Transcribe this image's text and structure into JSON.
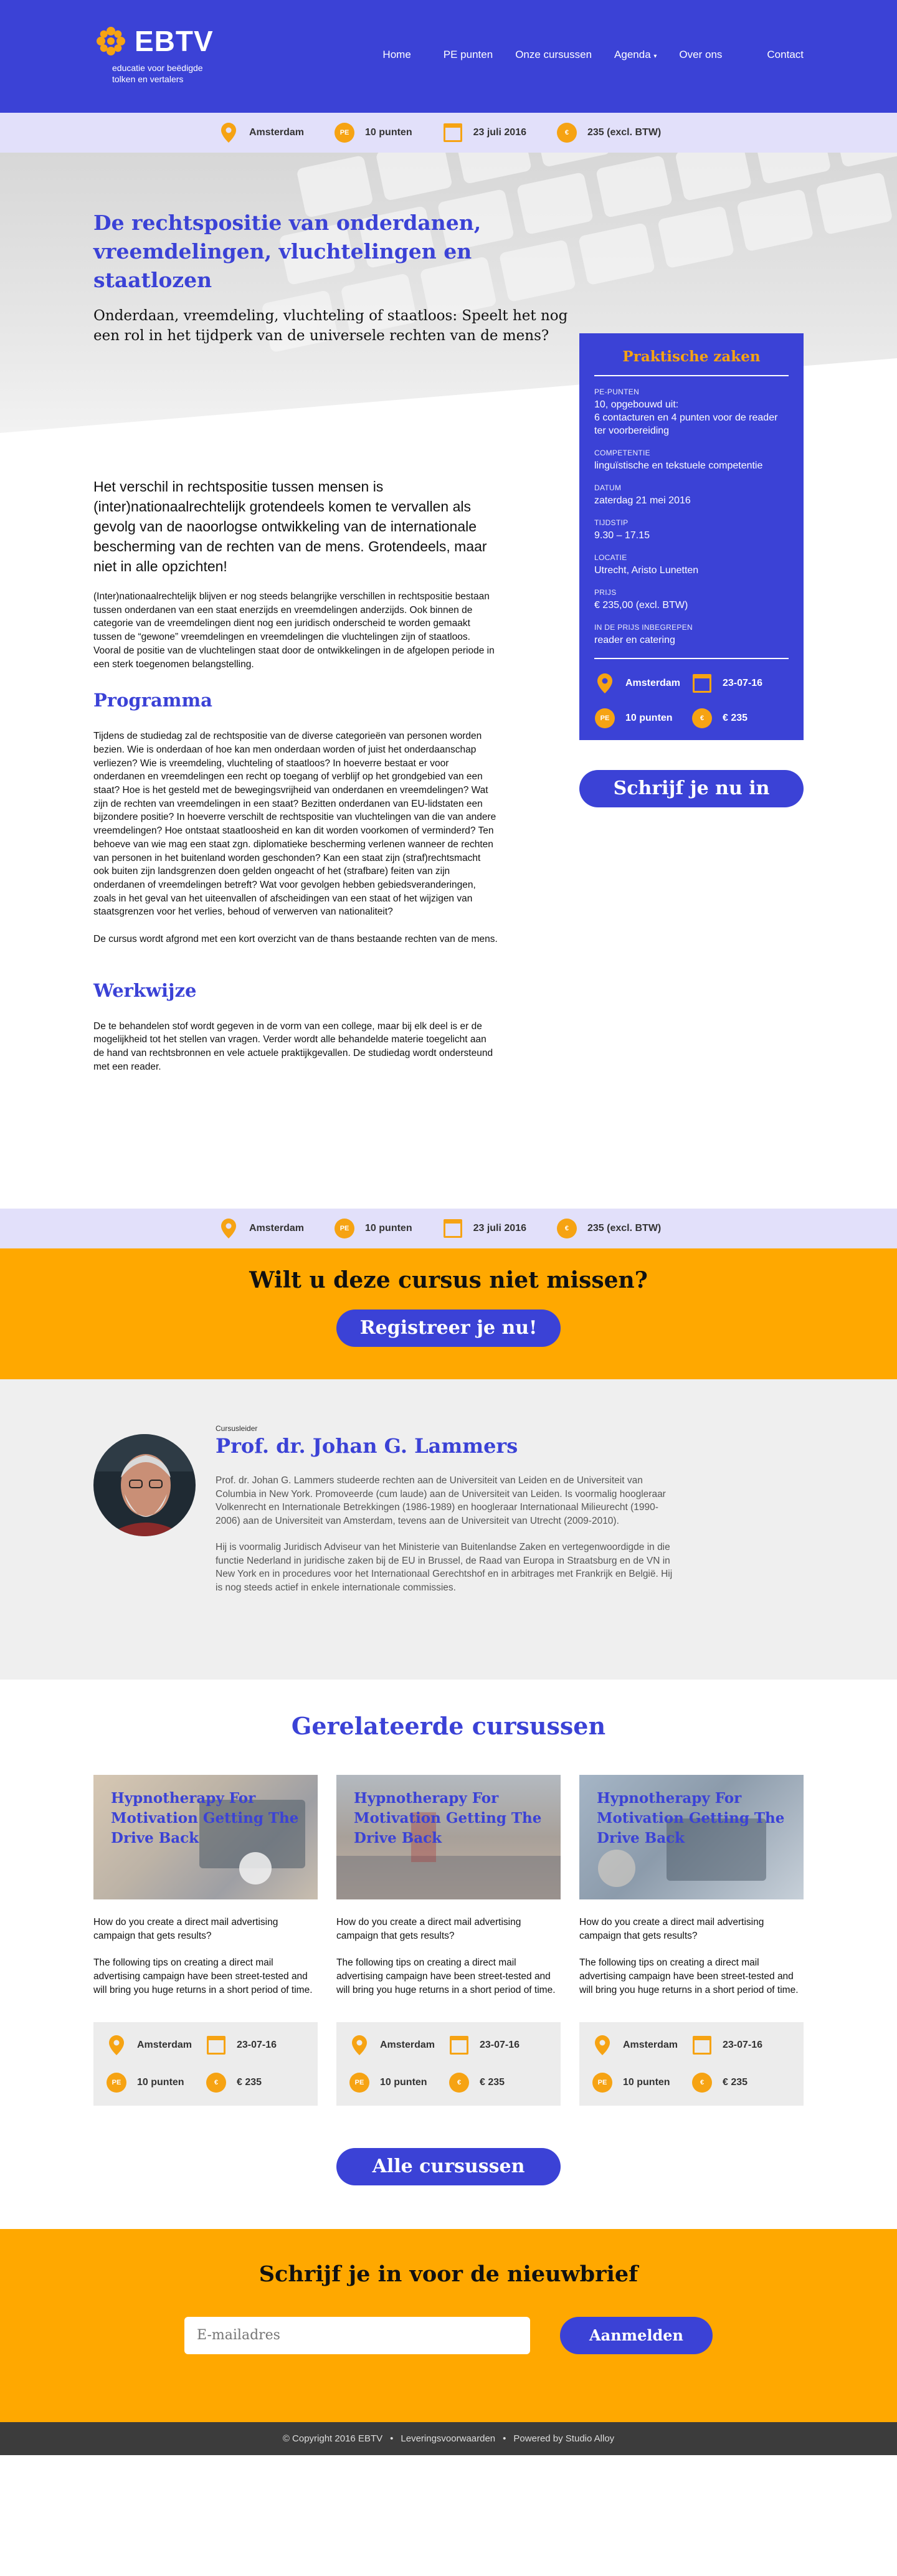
{
  "header": {
    "logo_word": "EBTV",
    "logo_sub_1": "educatie voor beëdigde",
    "logo_sub_2": "tolken en vertalers",
    "nav": [
      "Home",
      "PE punten",
      "Onze cursussen",
      "Agenda",
      "Over ons",
      "Contact"
    ]
  },
  "infobar": {
    "location": "Amsterdam",
    "points": "10 punten",
    "date": "23 juli 2016",
    "price": "235 (excl. BTW)",
    "pe_badge": "PE",
    "euro_badge": "€"
  },
  "hero": {
    "title": "De rechtspositie van onderdanen, vreemdelingen, vluchtelingen en staatlozen",
    "subtitle": "Onderdaan, vreemdeling, vluchteling of staatloos: Speelt het nog een rol in het tijdperk van de universele rechten van de mens?"
  },
  "content": {
    "lead": "Het verschil in rechtspositie tussen mensen is (inter)nationaalrechtelijk grotendeels komen te vervallen als gevolg van de naoorlogse ontwikkeling van de internationale bescherming van de rechten van de mens. Grotendeels, maar niet in alle opzichten!",
    "intro_1": "(Inter)nationaalrechtelijk blijven er nog steeds belangrijke verschillen in rechtspositie bestaan tussen onderdanen van een staat enerzijds en vreemdelingen anderzijds. Ook binnen de categorie van de vreemdelingen dient nog een juridisch onderscheid te worden gemaakt tussen de “gewone” vreemdelingen en vreemdelingen die vluchtelingen zijn of staatloos.",
    "intro_2": "Vooral de positie van de vluchtelingen staat door de ontwikkelingen in de afgelopen periode in een sterk toegenomen belangstelling.",
    "programma_title": "Programma",
    "programma_p1": "Tijdens de studiedag zal de rechtspositie van de diverse categorieën van personen worden bezien. Wie is onderdaan of hoe kan men onderdaan worden of juist het onderdaanschap verliezen? Wie is vreemdeling, vluchteling of staatloos? In hoeverre bestaat er voor onderdanen en vreemdelingen een recht op toegang of verblijf op het grondgebied van een staat? Hoe is het gesteld met de bewegingsvrijheid van onderdanen en vreemdelingen? Wat zijn de rechten van vreemdelingen in een staat? Bezitten onderdanen van EU-lidstaten een bijzondere positie? In hoeverre verschilt de rechtspositie van vluchtelingen van die van andere vreemdelingen? Hoe ontstaat staatloosheid en kan dit worden voorkomen of verminderd? Ten behoeve van wie mag een staat zgn. diplomatieke bescherming verlenen wanneer de rechten van personen in het buitenland worden geschonden? Kan een staat zijn (straf)rechtsmacht ook buiten zijn landsgrenzen doen gelden ongeacht of het (strafbare) feiten van zijn onderdanen of vreemdelingen betreft? Wat voor gevolgen hebben gebiedsveranderingen, zoals in het geval van het uiteenvallen of afscheidingen van een staat of het wijzigen van staatsgrenzen voor het verlies, behoud of verwerven van nationaliteit?",
    "programma_p2": "De cursus wordt afgrond met een kort overzicht van de thans bestaande rechten van de mens.",
    "werkwijze_title": "Werkwijze",
    "werkwijze_p": "De te behandelen stof wordt gegeven in de vorm van een college, maar bij elk deel is er de mogelijkheid tot het stellen van vragen. Verder wordt alle behandelde materie toegelicht aan de hand van rechtsbronnen en vele actuele praktijkgevallen. De studiedag wordt ondersteund met een reader."
  },
  "sidebar": {
    "title": "Praktische zaken",
    "rows": [
      {
        "label": "PE-punten",
        "value": "10, opgebouwd uit:\n6 contacturen en 4 punten voor de reader ter voorbereiding"
      },
      {
        "label": "Competentie",
        "value": "linguïstische en tekstuele competentie"
      },
      {
        "label": "Datum",
        "value": "zaterdag 21 mei 2016"
      },
      {
        "label": "Tijdstip",
        "value": "9.30 – 17.15"
      },
      {
        "label": "Locatie",
        "value": "Utrecht, Aristo Lunetten"
      },
      {
        "label": "Prijs",
        "value": "€ 235,00 (excl. BTW)"
      },
      {
        "label": "In de prijs inbegrepen",
        "value": "reader en catering"
      }
    ],
    "grid": {
      "location": "Amsterdam",
      "date": "23-07-16",
      "points": "10 punten",
      "price": "€ 235"
    },
    "button": "Schrijf je nu in"
  },
  "infobar2": {
    "location": "Amsterdam",
    "points": "10 punten",
    "date": "23 juli 2016",
    "price": "235 (excl. BTW)"
  },
  "cta": {
    "title": "Wilt u deze cursus niet missen?",
    "button": "Registreer je nu!"
  },
  "teacher": {
    "label": "Cursusleider",
    "name": "Prof. dr. Johan G. Lammers",
    "p1": "Prof. dr. Johan G. Lammers studeerde rechten aan de Universiteit van Leiden en de Universiteit van Columbia in New York. Promoveerde (cum laude) aan de Universiteit van Leiden. Is voormalig hoogleraar Volkenrecht en Internationale Betrekkingen (1986-1989) en hoogleraar Internationaal Milieurecht (1990-2006) aan de Universiteit van Amsterdam, tevens aan de Universiteit van Utrecht (2009-2010).",
    "p2": "Hij is voormalig Juridisch Adviseur van het Ministerie van Buitenlandse Zaken en vertegenwoordigde in die functie Nederland in juridische zaken bij de EU in Brussel, de Raad van Europa in Straatsburg en de VN in New York en in procedures voor het Internationaal Gerechtshof en in arbitrages met Frankrijk en België. Hij is nog steeds actief in enkele internationale commissies."
  },
  "related": {
    "title": "Gerelateerde cursussen",
    "cards": [
      {
        "title": "Hypnotherapy For Motivation Getting The Drive Back",
        "p1": "How do you create a direct mail advertising campaign that gets results?",
        "p2": "The following tips on creating a direct mail advertising campaign have been street-tested and will bring you huge returns in a short period of time.",
        "location": "Amsterdam",
        "date": "23-07-16",
        "points": "10 punten",
        "price": "€ 235"
      },
      {
        "title": "Hypnotherapy For Motivation Getting The Drive Back",
        "p1": "How do you create a direct mail advertising campaign that gets results?",
        "p2": "The following tips on creating a direct mail advertising campaign have been street-tested and will bring you huge returns in a short period of time.",
        "location": "Amsterdam",
        "date": "23-07-16",
        "points": "10 punten",
        "price": "€ 235"
      },
      {
        "title": "Hypnotherapy For Motivation Getting The Drive Back",
        "p1": "How do you create a direct mail advertising campaign that gets results?",
        "p2": "The following tips on creating a direct mail advertising campaign have been street-tested and will bring you huge returns in a short period of time.",
        "location": "Amsterdam",
        "date": "23-07-16",
        "points": "10 punten",
        "price": "€ 235"
      }
    ],
    "button": "Alle cursussen"
  },
  "newsletter": {
    "title": "Schrijf je in voor de nieuwbrief",
    "placeholder": "E-mailadres",
    "button": "Aanmelden"
  },
  "footer": {
    "copyright": "© Copyright  2016  EBTV",
    "terms": "Leveringsvoorwaarden",
    "powered": "Powered by Studio Alloy",
    "dot": "•"
  },
  "colors": {
    "brand_blue": "#3b42d6",
    "accent_orange": "#ffa800",
    "icon_orange": "#f6a313",
    "infobar_bg": "#e2e0fa"
  }
}
